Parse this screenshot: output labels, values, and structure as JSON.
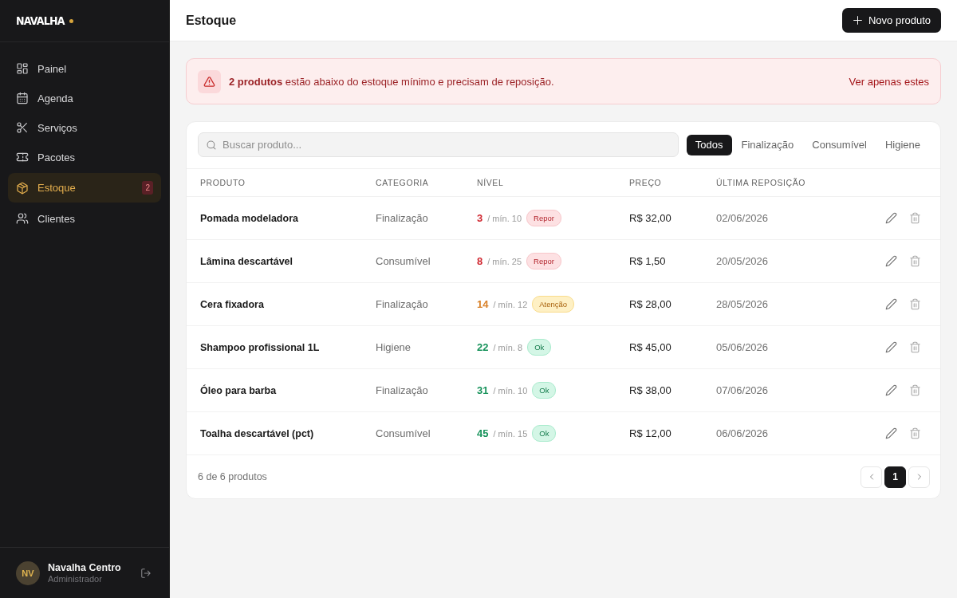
{
  "sidebar": {
    "brand": "NAVALHA",
    "items": [
      {
        "label": "Painel",
        "selected": false
      },
      {
        "label": "Agenda",
        "selected": false
      },
      {
        "label": "Serviços",
        "selected": false
      },
      {
        "label": "Pacotes",
        "selected": false
      },
      {
        "label": "Estoque",
        "selected": true,
        "badge": "2"
      },
      {
        "label": "Clientes",
        "selected": false
      }
    ],
    "user": {
      "initials": "NV",
      "name": "Navalha Centro",
      "role": "Administrador"
    }
  },
  "header": {
    "title": "Estoque",
    "action": "Novo produto"
  },
  "alert": {
    "message": "**2 produtos** estão abaixo do estoque mínimo e precisam de reposição.",
    "link": "Ver apenas estes"
  },
  "toolbar": {
    "search": {
      "placeholder": "Buscar produto..."
    },
    "filters": [
      {
        "label": "Todos",
        "selected": true
      },
      {
        "label": "Finalização",
        "selected": false
      },
      {
        "label": "Consumível",
        "selected": false
      },
      {
        "label": "Higiene",
        "selected": false
      }
    ]
  },
  "table": {
    "columns": [
      "PRODUTO",
      "CATEGORIA",
      "NÍVEL",
      "PREÇO",
      "ÚLTIMA REPOSIÇÃO"
    ],
    "rows": [
      {
        "product": "Pomada modeladora",
        "category": "Finalização",
        "stock": "3",
        "minimum": "/ mín. 10",
        "kind": "low",
        "badge": "Repor",
        "price": "R$ 32,00",
        "last_restock": "02/06/2026"
      },
      {
        "product": "Lâmina descartável",
        "category": "Consumível",
        "stock": "8",
        "minimum": "/ mín. 25",
        "kind": "low",
        "badge": "Repor",
        "price": "R$ 1,50",
        "last_restock": "20/05/2026"
      },
      {
        "product": "Cera fixadora",
        "category": "Finalização",
        "stock": "14",
        "minimum": "/ mín. 12",
        "kind": "warn",
        "badge": "Atenção",
        "price": "R$ 28,00",
        "last_restock": "28/05/2026"
      },
      {
        "product": "Shampoo profissional 1L",
        "category": "Higiene",
        "stock": "22",
        "minimum": "/ mín. 8",
        "kind": "ok",
        "badge": "Ok",
        "price": "R$ 45,00",
        "last_restock": "05/06/2026"
      },
      {
        "product": "Óleo para barba",
        "category": "Finalização",
        "stock": "31",
        "minimum": "/ mín. 10",
        "kind": "ok",
        "badge": "Ok",
        "price": "R$ 38,00",
        "last_restock": "07/06/2026"
      },
      {
        "product": "Toalha descartável (pct)",
        "category": "Consumível",
        "stock": "45",
        "minimum": "/ mín. 15",
        "kind": "ok",
        "badge": "Ok",
        "price": "R$ 12,00",
        "last_restock": "06/06/2026"
      }
    ]
  },
  "footer": {
    "count": "6 de 6 produtos",
    "pages": [
      {
        "label": "1",
        "selected": true
      }
    ]
  }
}
